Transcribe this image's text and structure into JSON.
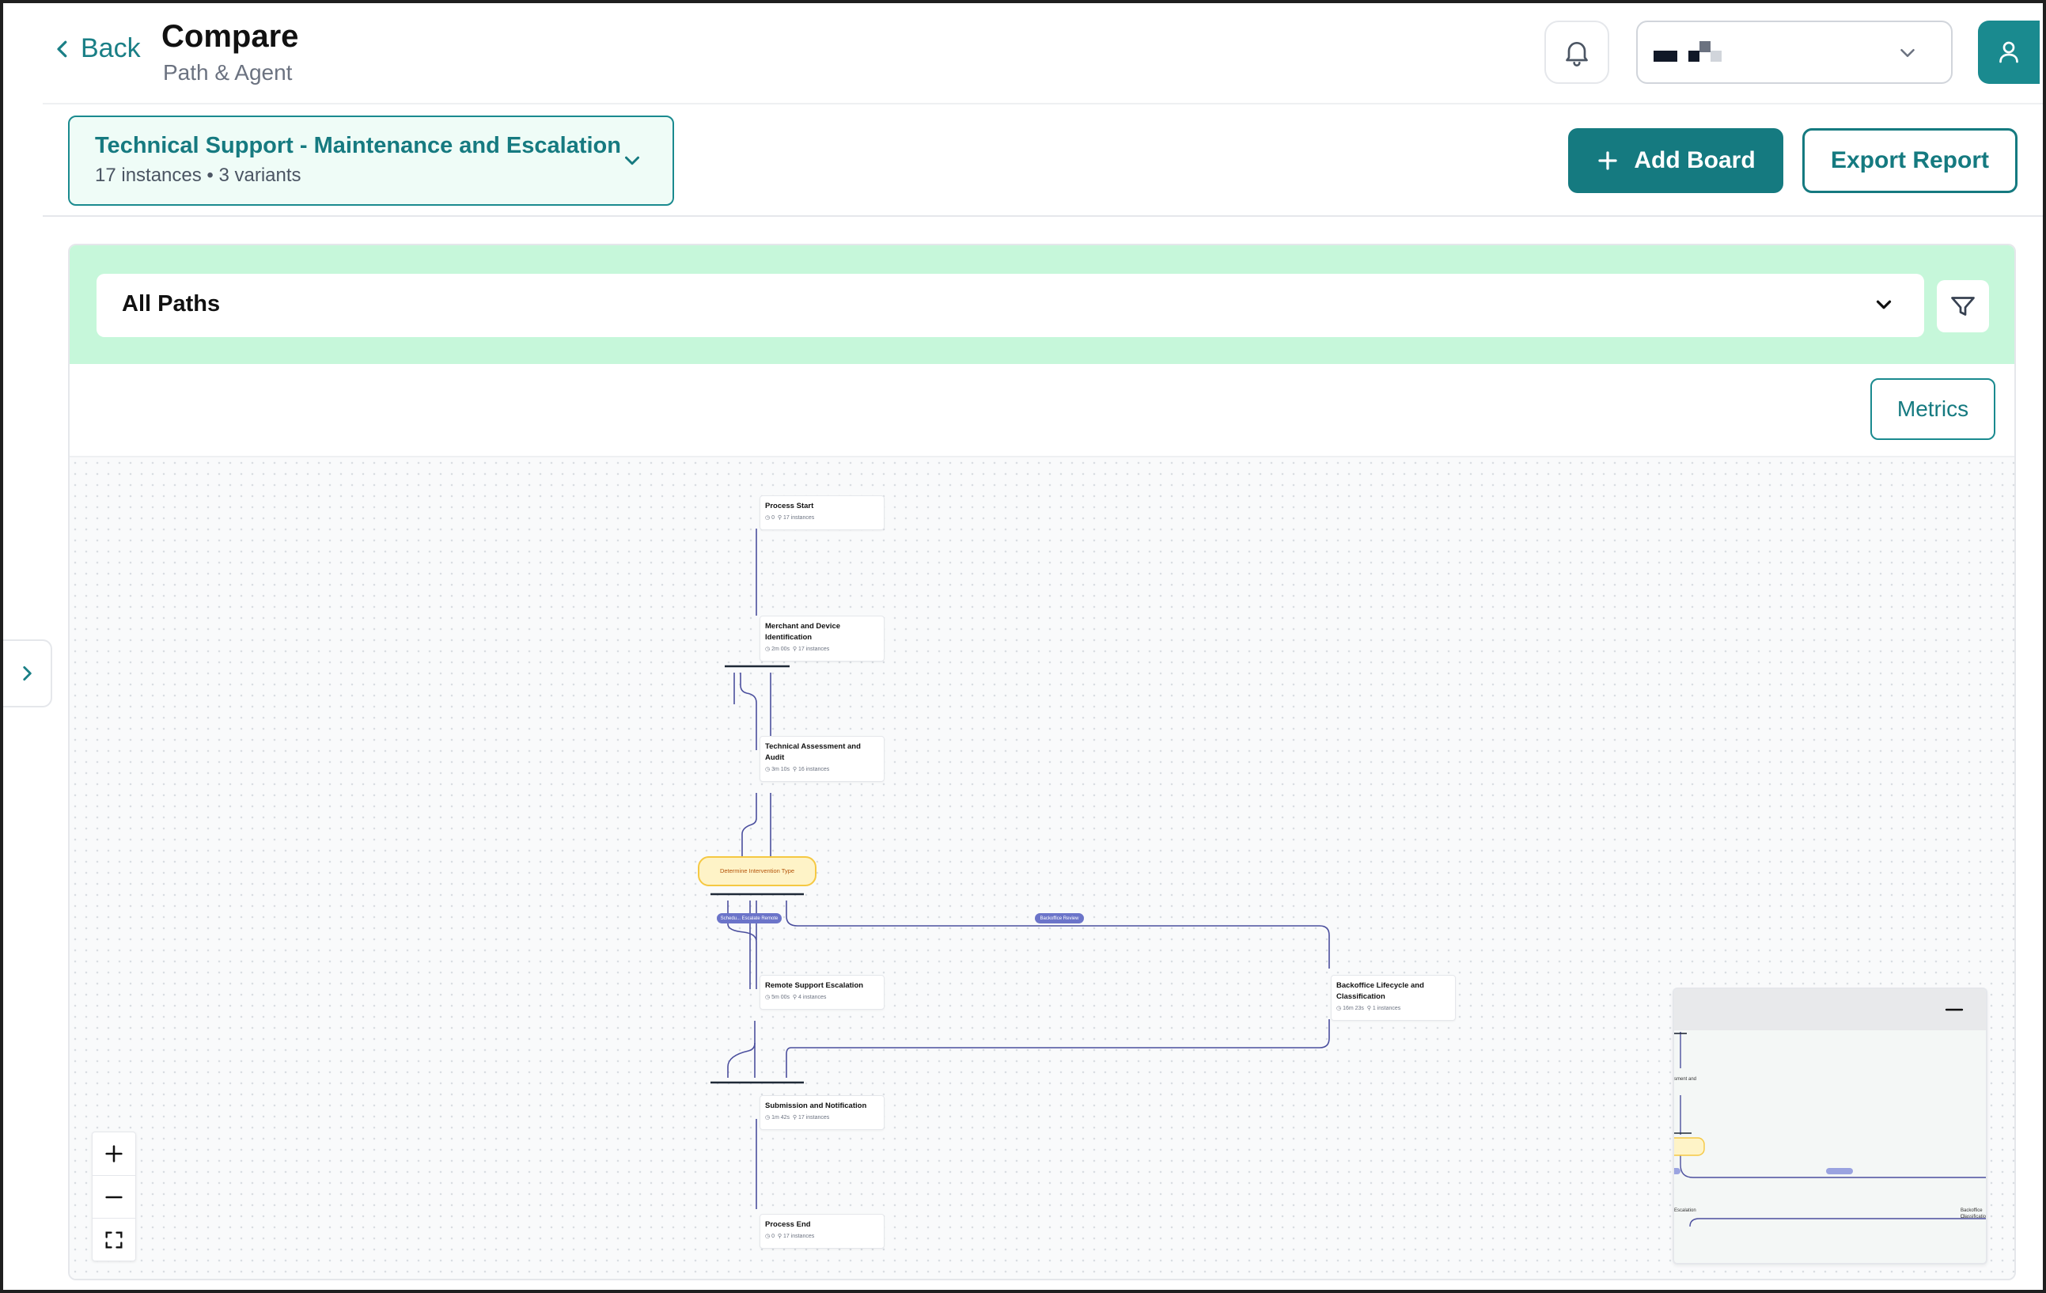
{
  "header": {
    "back_label": "Back",
    "title": "Compare",
    "subtitle": "Path & Agent"
  },
  "process": {
    "name": "Technical Support - Maintenance and Escalation",
    "meta": "17 instances • 3 variants"
  },
  "actions": {
    "add_board": "Add Board",
    "export_report": "Export Report"
  },
  "board": {
    "paths_label": "All Paths",
    "metrics_label": "Metrics"
  },
  "flow": {
    "nodes": [
      {
        "title": "Process Start",
        "duration": "0",
        "instances": "17 instances"
      },
      {
        "title": "Merchant and Device Identification",
        "duration": "2m 00s",
        "instances": "17 instances"
      },
      {
        "title": "Technical Assessment and Audit",
        "duration": "3m 10s",
        "instances": "16 instances"
      },
      {
        "title": "Remote Support Escalation",
        "duration": "5m 00s",
        "instances": "4 instances"
      },
      {
        "title": "Backoffice Lifecycle and Classification",
        "duration": "16m 23s",
        "instances": "1 instances"
      },
      {
        "title": "Submission and Notification",
        "duration": "1m 42s",
        "instances": "17 instances"
      },
      {
        "title": "Process End",
        "duration": "0",
        "instances": "17 instances"
      }
    ],
    "decision": "Determine Intervention Type",
    "branch_labels": [
      "Schedu... Escalate Remote",
      "Backoffice Review"
    ]
  },
  "minimap": {
    "labels": [
      "sment and",
      "Escalation",
      "Backoffice Li",
      "Classification"
    ]
  },
  "colors": {
    "accent": "#157a80",
    "board_header": "#c6f7da",
    "edge": "#4b4f9e",
    "decision_fill": "#fef3c7",
    "pill": "#6b74c9"
  }
}
